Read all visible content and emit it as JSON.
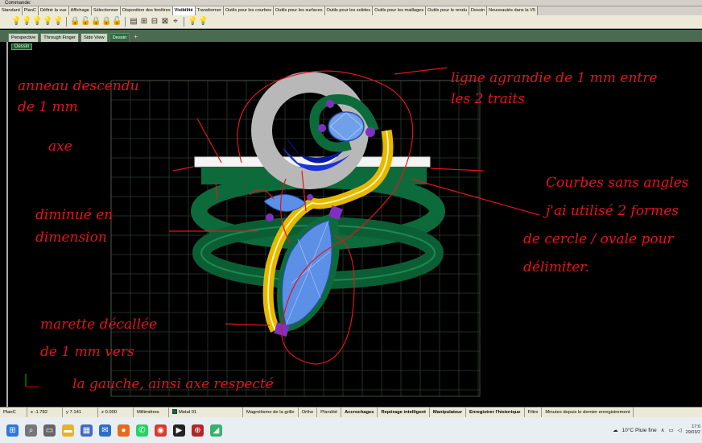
{
  "window": {
    "command_label": "Commande:"
  },
  "tabs": [
    "Standard",
    "PlanC",
    "Définir la vue",
    "Affichage",
    "Sélectionner",
    "Disposition des fenêtres",
    "Visibilité",
    "Transformer",
    "Outils pour les courbes",
    "Outils pour les surfaces",
    "Outils pour les solides",
    "Outils pour les maillages",
    "Outils pour le rendu",
    "Dessin",
    "Nouveautés dans la V5"
  ],
  "active_tab": "Visibilité",
  "viewport_tabs": [
    "Perspective",
    "Through Finger",
    "Side View",
    "Dessin"
  ],
  "active_viewport_tab": "Dessin",
  "viewport_label": "Dessin",
  "annotations": {
    "anneau": [
      "anneau descendu",
      "de 1 mm"
    ],
    "axe": "axe",
    "diminue": [
      "diminué en",
      "dimension"
    ],
    "marquise": [
      "marette décallée",
      "de 1 mm vers",
      "la gauche, ainsi axe respecté"
    ],
    "ligne": [
      "ligne agrandie de 1 mm entre",
      "les 2 traits"
    ],
    "courbes": [
      "Courbes sans angles",
      "j'ai utilisé 2 formes",
      "de cercle / ovale pour",
      "délimiter."
    ]
  },
  "statusbar": {
    "plane": "PlanC",
    "x": "x -1.782",
    "y": "y 7.141",
    "z": "z 0.000",
    "units": "Millimètres",
    "layer": "Metal 01",
    "snap": "Magnétisme de la grille",
    "ortho": "Ortho",
    "planar": "Planéité",
    "osnap": "Accrochages",
    "smarttrack": "Repérage intelligent",
    "gumball": "Manipulateur",
    "history": "Enregistrer l'historique",
    "filter": "Filtre",
    "minutes": "Minutes depuis le dernier enregistrement"
  },
  "taskbar": {
    "weather": "10°C Pluie fine",
    "time": "17:0",
    "date": "29/03/2"
  },
  "colors": {
    "metal_green": "#0d6b3b",
    "gold": "#e6b800",
    "silver": "#b8b8b8",
    "stone_blue": "#5c8fe6",
    "annotation_red": "#e3141c"
  }
}
